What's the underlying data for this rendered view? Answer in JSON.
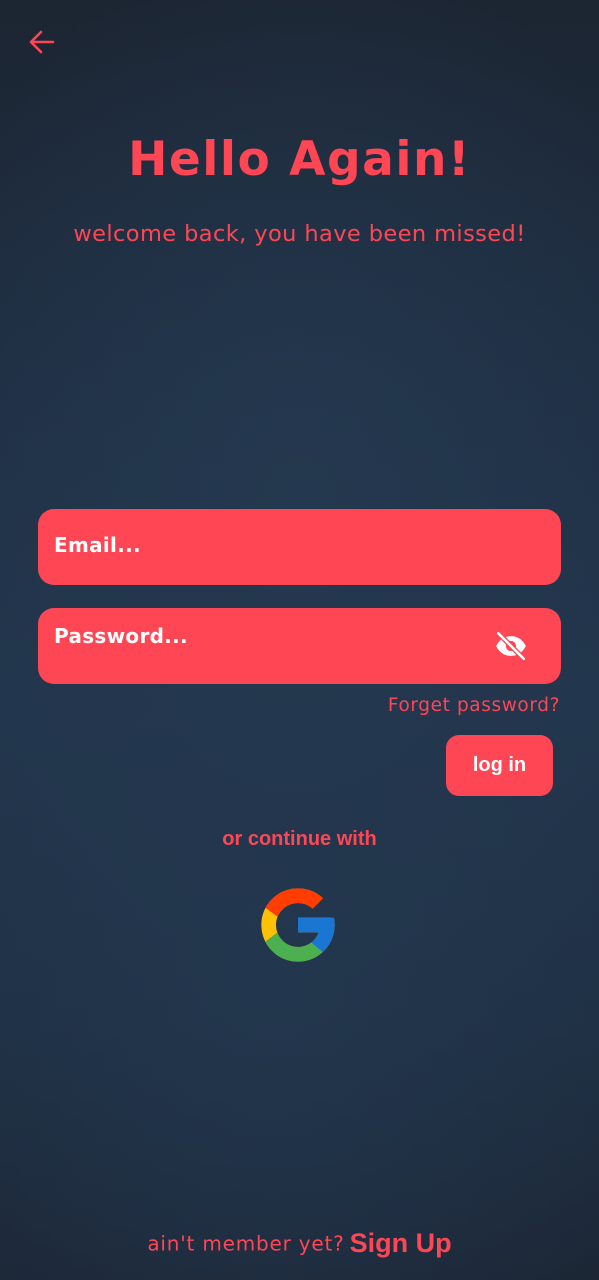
{
  "header": {
    "back_icon": "arrow-left-icon"
  },
  "greeting": {
    "title": "Hello Again!",
    "subtitle": "welcome back, you have been missed!"
  },
  "form": {
    "email_placeholder": "Email...",
    "email_value": "",
    "password_placeholder": "Password...",
    "password_value": "",
    "password_toggle_icon": "eye-off-icon",
    "forgot_label": "Forget password?",
    "login_label": "log in"
  },
  "social": {
    "divider_text": "or continue with",
    "google_icon": "google-logo-icon"
  },
  "footer": {
    "prompt": "ain't member yet?",
    "signup_label": "Sign Up"
  },
  "colors": {
    "accent": "#ff4655",
    "background_top": "#1c2532",
    "background_mid": "#22354c",
    "text_on_accent": "#ffffff"
  }
}
